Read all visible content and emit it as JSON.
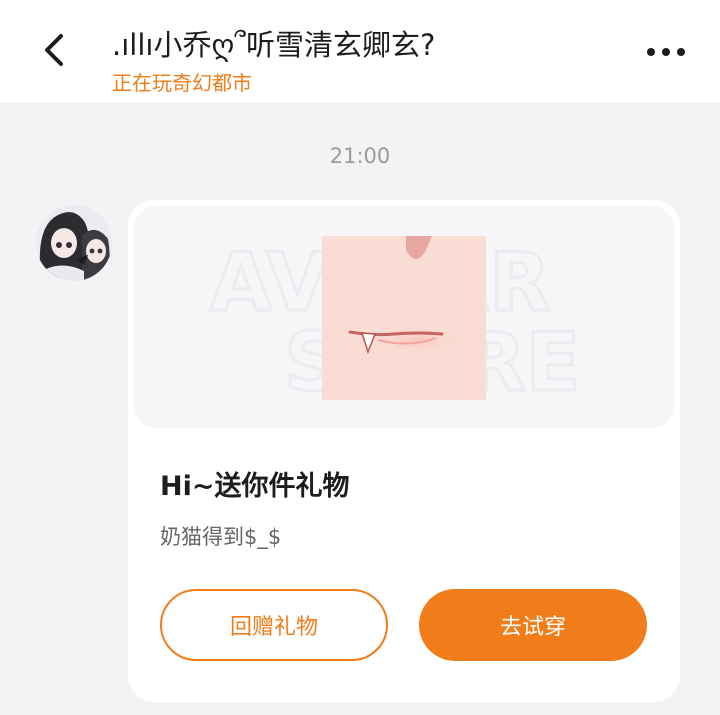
{
  "header": {
    "title": ".ıllı小乔ღ՞听雪清玄卿玄?",
    "status": "正在玩奇幻都市",
    "back_icon": "chevron-left-icon",
    "more_icon": "more-horizontal-icon"
  },
  "chat": {
    "time": "21:00",
    "message": {
      "gift_title": "Hi~送你件礼物",
      "gift_description": "奶猫得到$_$",
      "preview_watermark": "AVATAR STORE",
      "buttons": {
        "return_gift": "回赠礼物",
        "try_on": "去试穿"
      }
    }
  },
  "colors": {
    "accent": "#f07d1a",
    "background": "#f3f3f5",
    "card": "#ffffff"
  }
}
